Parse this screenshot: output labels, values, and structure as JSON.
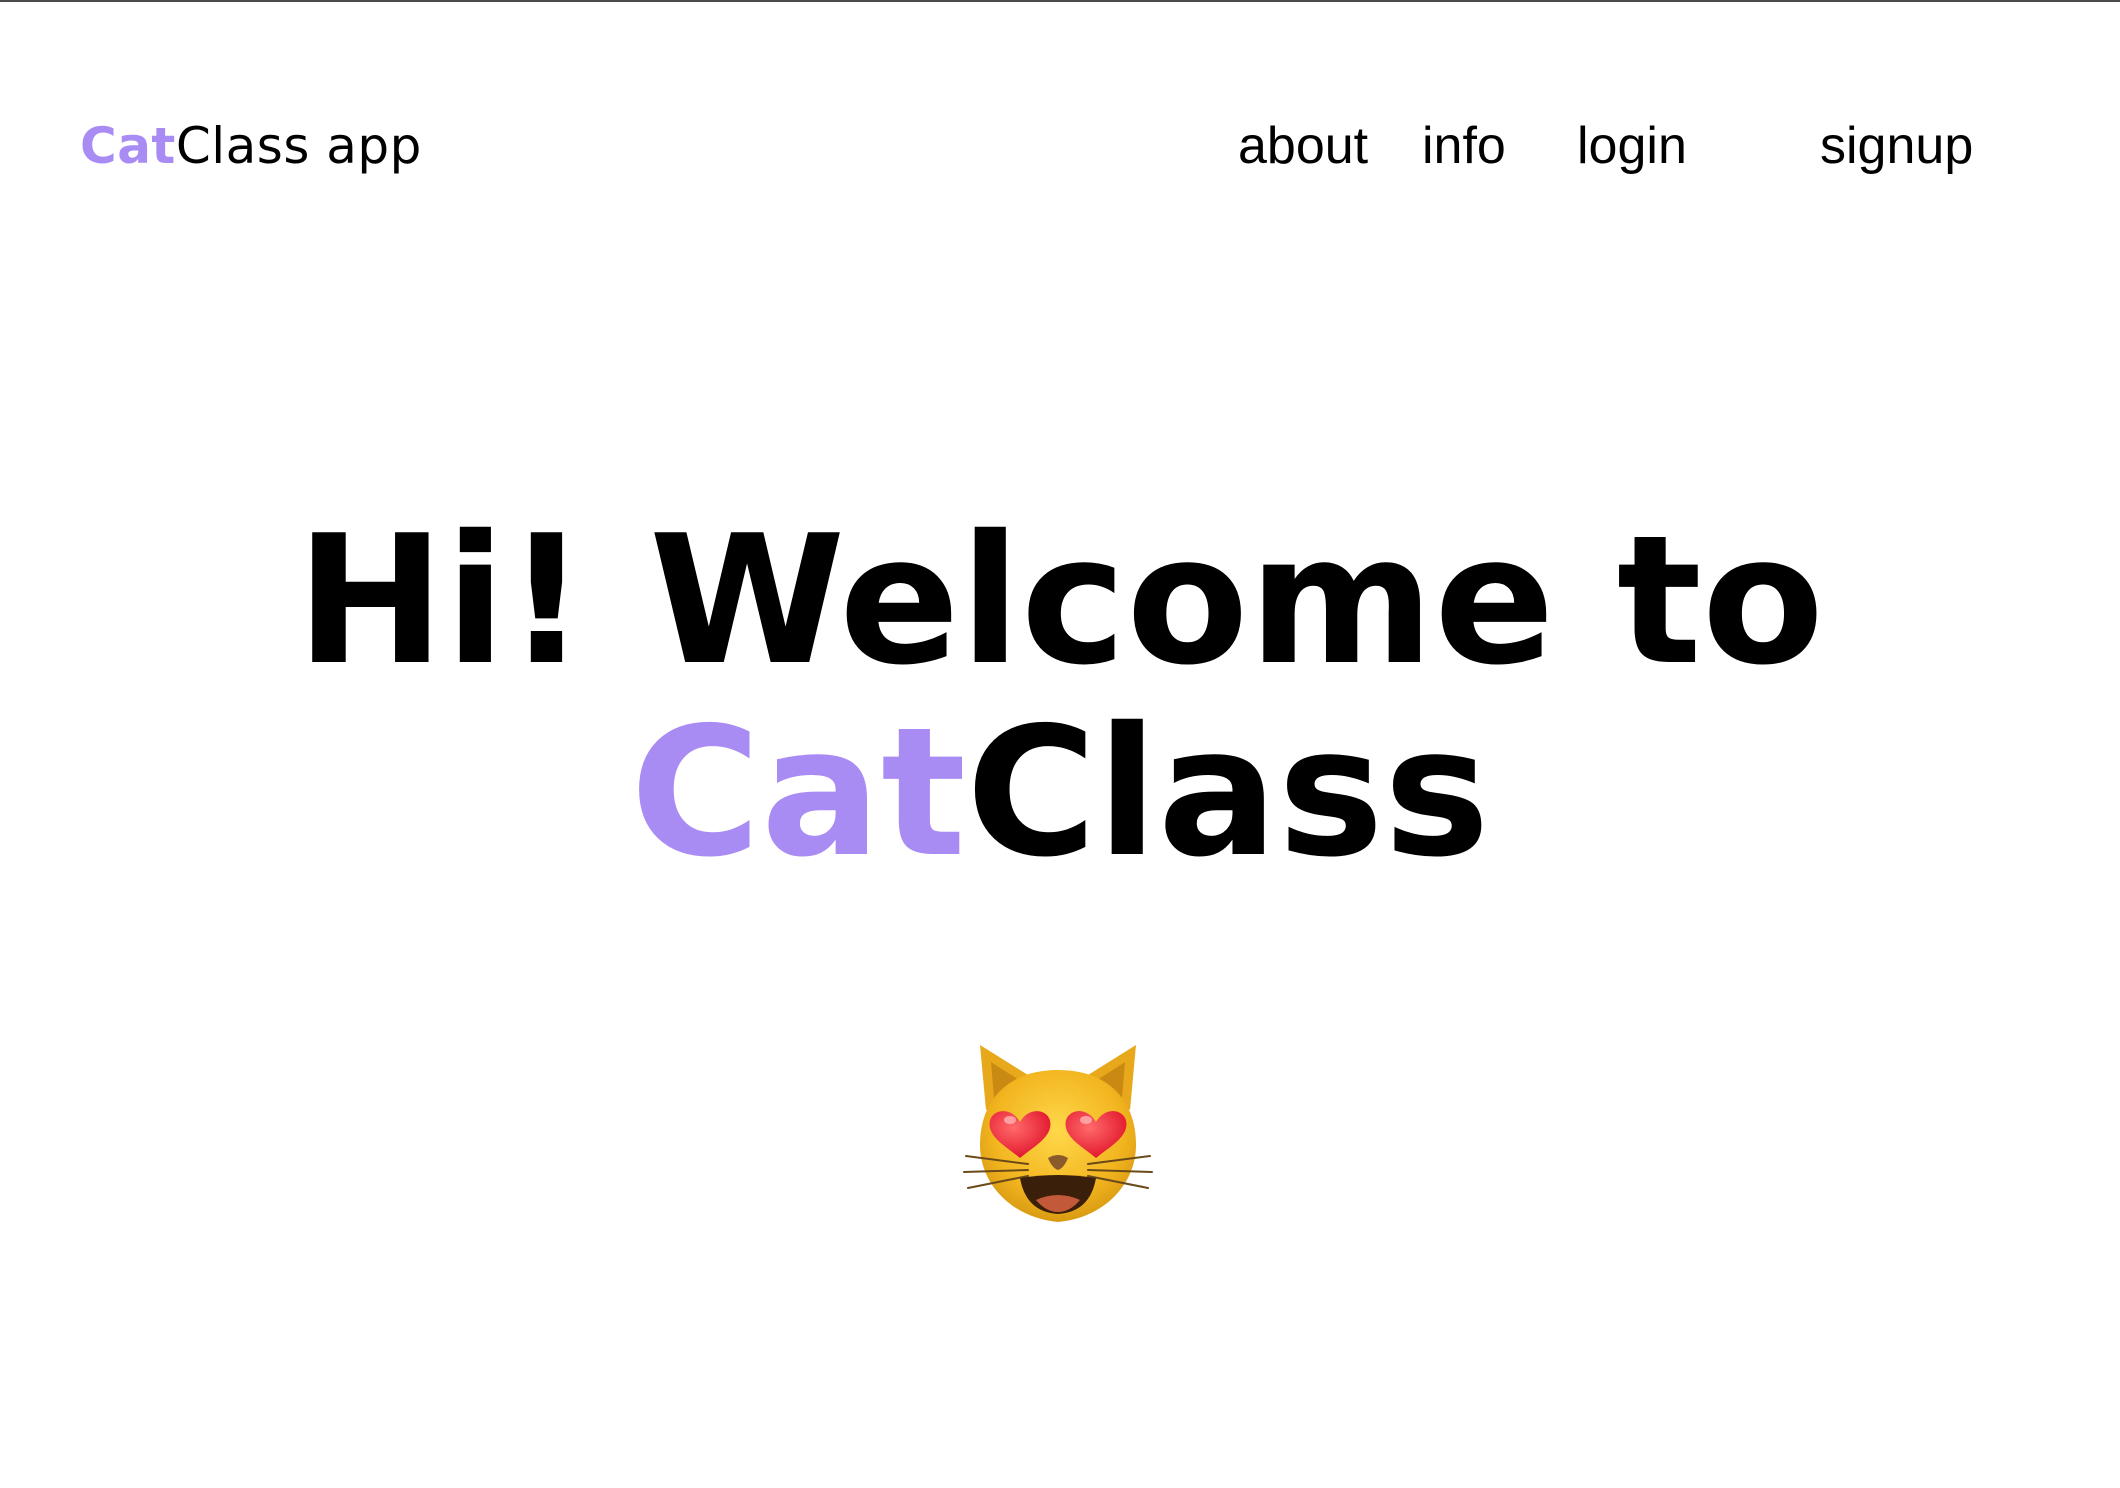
{
  "header": {
    "brand_accent": "Cat",
    "brand_rest": "Class app"
  },
  "nav": {
    "about": "about",
    "info": "info",
    "login": "login",
    "signup": "signup"
  },
  "hero": {
    "line1": "Hi! Welcome to",
    "line2_accent": "Cat",
    "line2_rest": "Class",
    "emoji": "smiling-cat-heart-eyes-icon"
  },
  "colors": {
    "accent": "#a98bf4",
    "text": "#000000",
    "background": "#ffffff"
  }
}
